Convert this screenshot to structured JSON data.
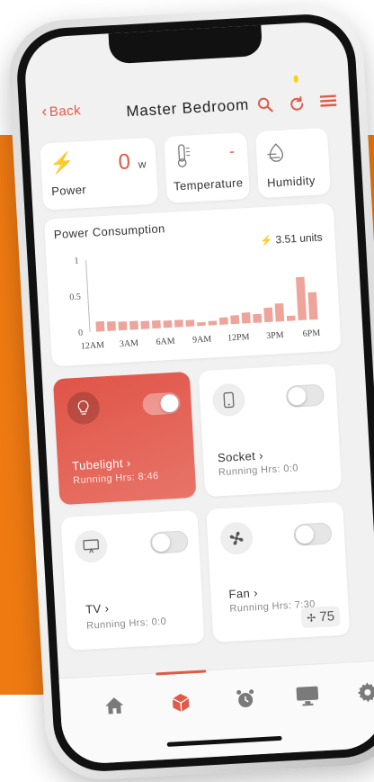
{
  "header": {
    "back_label": "Back",
    "title": "Master Bedroom"
  },
  "stats": {
    "power": {
      "label": "Power",
      "value": "0",
      "unit": "w"
    },
    "temperature": {
      "label": "Temperature",
      "value": "-"
    },
    "humidity": {
      "label": "Humidity"
    }
  },
  "power_consumption": {
    "title": "Power Consumption",
    "units": "3.51 units"
  },
  "chart_data": {
    "type": "bar",
    "x_ticks": [
      "12AM",
      "3AM",
      "6AM",
      "9AM",
      "12PM",
      "3PM",
      "6PM"
    ],
    "y_ticks": [
      "1",
      "0.5",
      "0"
    ],
    "ylim": [
      0,
      1
    ],
    "values": [
      0.14,
      0.13,
      0.12,
      0.12,
      0.11,
      0.11,
      0.1,
      0.1,
      0.09,
      0.05,
      0.06,
      0.1,
      0.12,
      0.15,
      0.12,
      0.2,
      0.25,
      0.07,
      0.6,
      0.38
    ]
  },
  "devices": [
    {
      "name": "Tubelight",
      "hours": "Running Hrs: 8:46",
      "on": true
    },
    {
      "name": "Socket",
      "hours": "Running Hrs: 0:0",
      "on": false
    },
    {
      "name": "TV",
      "hours": "Running Hrs: 0:0",
      "on": false
    },
    {
      "name": "Fan",
      "hours": "Running Hrs: 7:30",
      "on": false,
      "speed": "75"
    }
  ],
  "colors": {
    "accent": "#e05a48",
    "active_card": "#e0584a",
    "background_band": "#f07a12"
  },
  "tabs": [
    {
      "icon": "home-icon"
    },
    {
      "icon": "cube-icon",
      "active": true
    },
    {
      "icon": "alarm-icon"
    },
    {
      "icon": "monitor-icon"
    },
    {
      "icon": "gear-icon"
    }
  ]
}
